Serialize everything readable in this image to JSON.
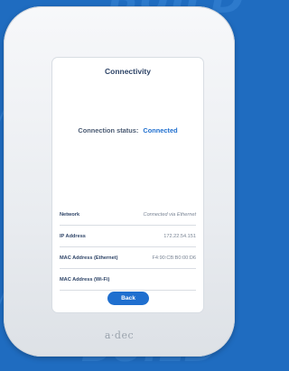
{
  "background": {
    "accent": "#1f6cc0",
    "pattern_color": "#3a86d6"
  },
  "screen": {
    "title": "Connectivity",
    "status_label": "Connection status:",
    "status_value": "Connected",
    "rows": [
      {
        "key": "Network",
        "value": "Connected via Ethernet"
      },
      {
        "key": "IP Address",
        "value": "172.22.54.151"
      },
      {
        "key": "MAC Address (Ethernet)",
        "value": "F4:90:CB:B0:00:D6"
      },
      {
        "key": "MAC Address (Wi-Fi)",
        "value": ""
      }
    ],
    "back_label": "Back"
  },
  "device": {
    "logo": "a·dec"
  },
  "colors": {
    "primary": "#1f6fcf",
    "heading": "#2e4467"
  }
}
